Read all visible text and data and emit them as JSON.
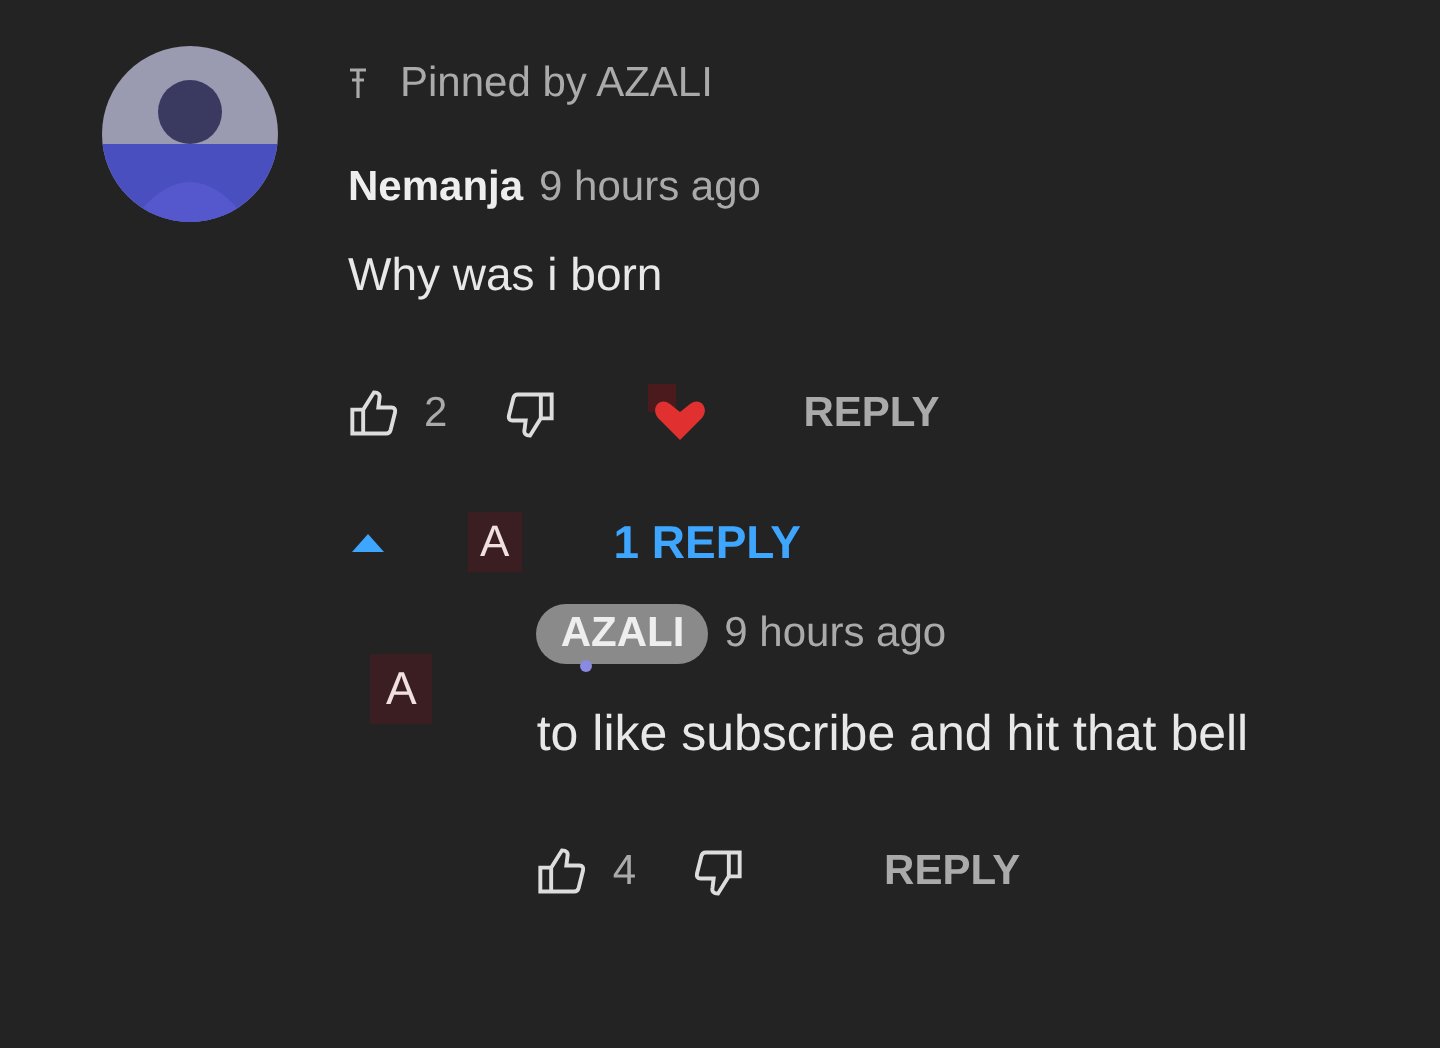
{
  "comment": {
    "pinned_label": "Pinned by AZALI",
    "author": "Nemanja",
    "time": "9 hours ago",
    "text": "Why was i born",
    "likes": "2",
    "hearted": true,
    "reply_label": "REPLY"
  },
  "replies_toggle": {
    "expanded": true,
    "avatar_letter": "A",
    "label": "1 REPLY"
  },
  "reply": {
    "avatar_letter": "A",
    "author": "AZALI",
    "author_is_creator": true,
    "time": "9 hours ago",
    "text": "to like subscribe and hit that bell",
    "likes": "4",
    "reply_label": "REPLY"
  }
}
